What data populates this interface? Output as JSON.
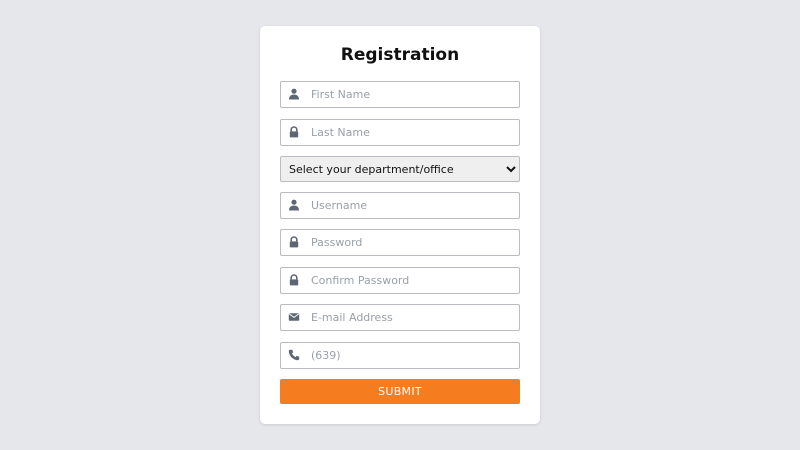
{
  "form": {
    "title": "Registration",
    "fields": [
      {
        "icon": "user-icon",
        "placeholder": "First Name"
      },
      {
        "icon": "lock-icon",
        "placeholder": "Last Name"
      },
      {
        "icon": "user-icon",
        "placeholder": "Username"
      },
      {
        "icon": "lock-icon",
        "placeholder": "Password"
      },
      {
        "icon": "lock-icon",
        "placeholder": "Confirm Password"
      },
      {
        "icon": "envelope-icon",
        "placeholder": "E-mail Address"
      },
      {
        "icon": "phone-icon",
        "placeholder": "(639)"
      }
    ],
    "department_select": {
      "selected": "Select your department/office"
    },
    "submit_label": "SUBMIT"
  },
  "colors": {
    "background": "#e5e7eb",
    "card": "#ffffff",
    "submit": "#f57c1f",
    "icon": "#5f6673"
  }
}
